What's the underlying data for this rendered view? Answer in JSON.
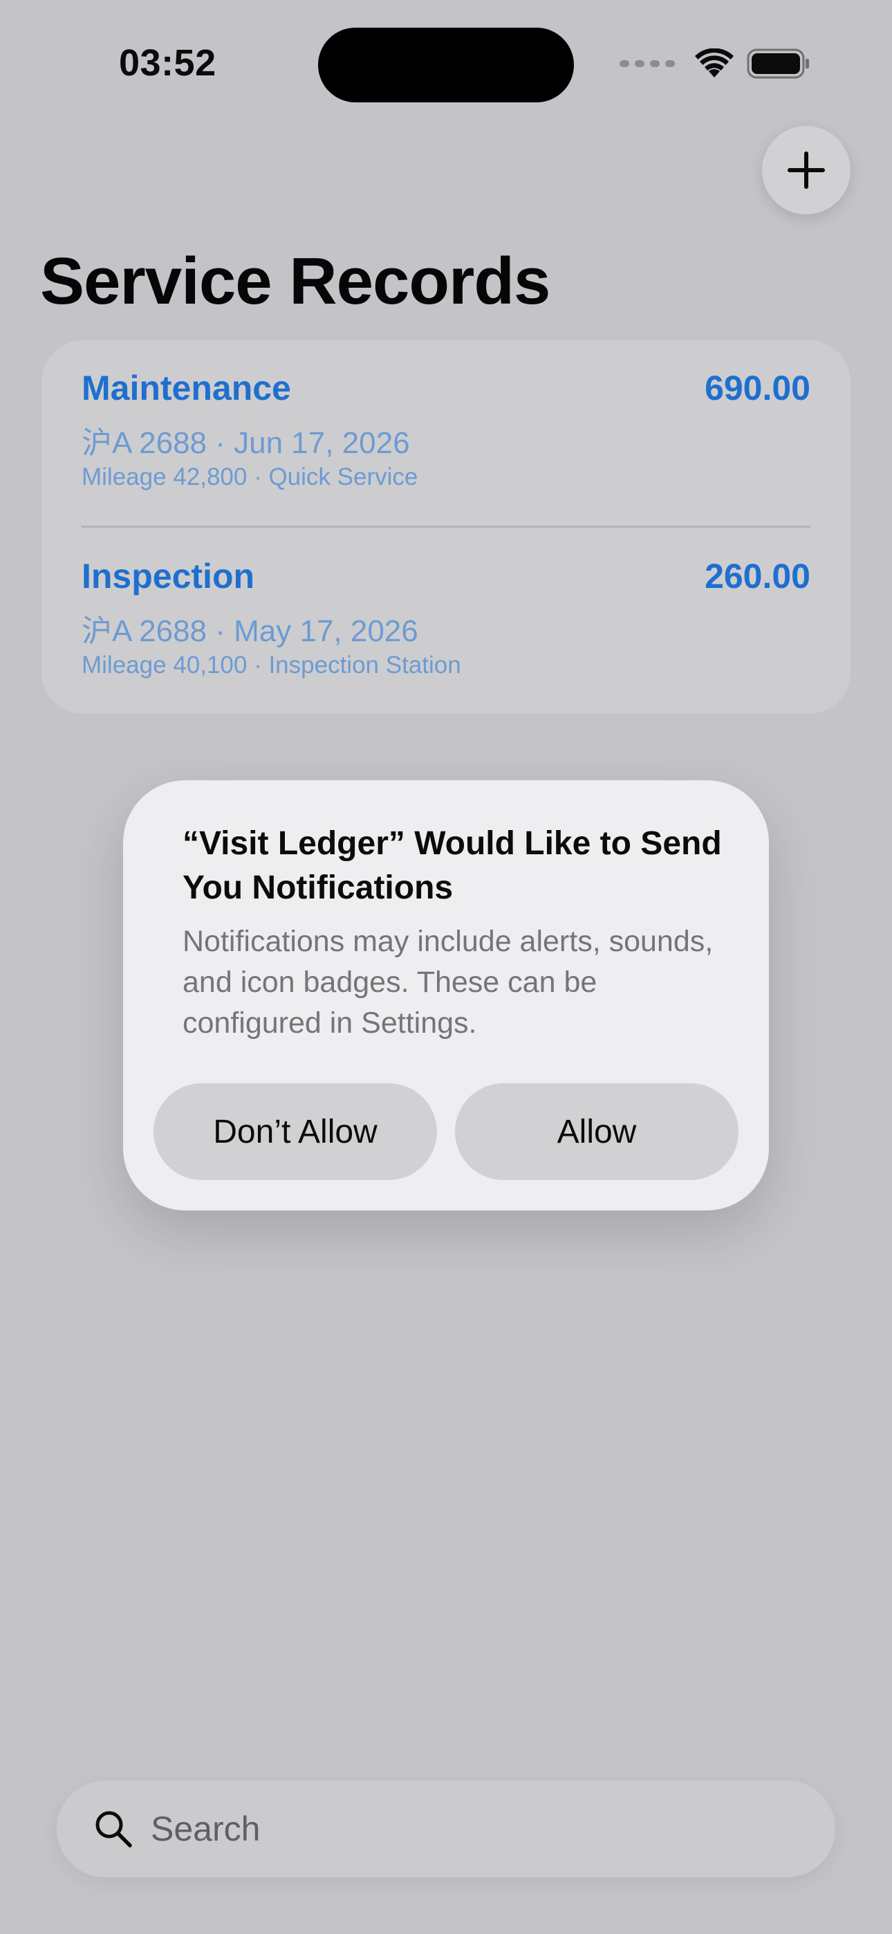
{
  "status_bar": {
    "time": "03:52"
  },
  "toolbar": {
    "add_icon": "plus-icon"
  },
  "page": {
    "title": "Service Records"
  },
  "records": [
    {
      "type": "Maintenance",
      "amount": "690.00",
      "subtitle": "沪A 2688 · Jun 17, 2026",
      "detail": "Mileage 42,800 · Quick Service"
    },
    {
      "type": "Inspection",
      "amount": "260.00",
      "subtitle": "沪A 2688 · May 17, 2026",
      "detail": "Mileage 40,100 · Inspection Station"
    }
  ],
  "alert": {
    "title": "“Visit Ledger” Would Like to Send You Notifications",
    "message": "Notifications may include alerts, sounds, and icon badges. These can be configured in Settings.",
    "deny_label": "Don’t Allow",
    "allow_label": "Allow"
  },
  "search": {
    "placeholder": "Search",
    "value": ""
  },
  "colors": {
    "accent": "#1f6fcf",
    "background": "#c3c3c8"
  }
}
